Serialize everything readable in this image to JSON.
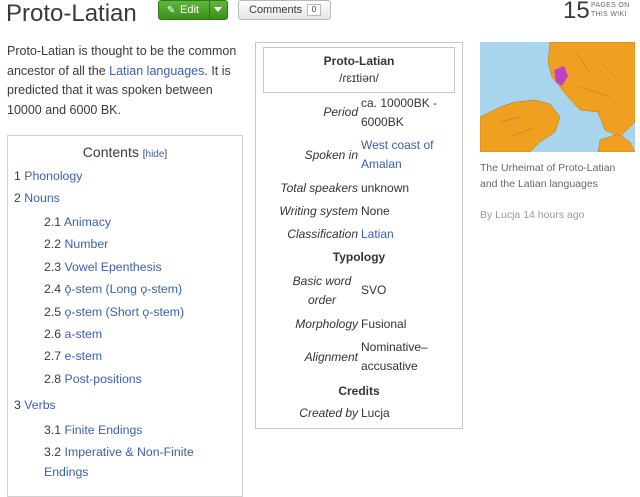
{
  "header": {
    "title": "Proto-Latian",
    "edit_label": "Edit",
    "comments_label": "Comments",
    "comments_count": "0",
    "pages_count": "15",
    "pages_label_line1": "PAGES ON",
    "pages_label_line2": "THIS WIKI"
  },
  "intro": {
    "p1": "Proto-Latian is thought to be the common ancestor of all the ",
    "link": "Latian languages",
    "p2": ". It is predicted that it was spoken between 10000 and 6000 BK."
  },
  "toc": {
    "title": "Contents",
    "hide": "hide",
    "items": [
      {
        "num": "1",
        "label": "Phonology"
      },
      {
        "num": "2",
        "label": "Nouns"
      },
      {
        "num": "2.1",
        "label": "Animacy"
      },
      {
        "num": "2.2",
        "label": "Number"
      },
      {
        "num": "2.3",
        "label": "Vowel Epenthesis"
      },
      {
        "num": "2.4",
        "label": "ǭ-stem (Long ǫ-stem)"
      },
      {
        "num": "2.5",
        "label": "ǫ-stem (Short ǫ-stem)"
      },
      {
        "num": "2.6",
        "label": "a-stem"
      },
      {
        "num": "2.7",
        "label": "e-stem"
      },
      {
        "num": "2.8",
        "label": "Post-positions"
      },
      {
        "num": "3",
        "label": "Verbs"
      },
      {
        "num": "3.1",
        "label": "Finite Endings"
      },
      {
        "num": "3.2",
        "label": "Imperative & Non-Finite"
      },
      {
        "num": "",
        "label": "Endings"
      }
    ]
  },
  "infobox": {
    "name": "Proto-Latian",
    "ipa": "/ɾɛɪtiən/",
    "period_label": "Period",
    "period_value_1": "ca. 10000BK -",
    "period_value_2": "6000BK",
    "spoken_label": "Spoken in",
    "spoken_value_1": "West coast of",
    "spoken_value_2": "Amalan",
    "speakers_label": "Total speakers",
    "speakers_value": "unknown",
    "writing_label": "Writing system",
    "writing_value": "None",
    "classification_label": "Classification",
    "classification_value": "Latian",
    "typology_heading": "Typology",
    "wordorder_label_1": "Basic word",
    "wordorder_label_2": "order",
    "wordorder_value": "SVO",
    "morphology_label": "Morphology",
    "morphology_value": "Fusional",
    "alignment_label": "Alignment",
    "alignment_value_1": "Nominative–",
    "alignment_value_2": "accusative",
    "credits_heading": "Credits",
    "createdby_label": "Created by",
    "createdby_value": "Lucja"
  },
  "map": {
    "caption": "The Urheimat of Proto-Latian and the Latian languages",
    "byline": "By Lucja 14 hours ago",
    "colors": {
      "sea": "#a8d4ee",
      "land": "#f0a020",
      "highlight": "#c040c8"
    }
  }
}
